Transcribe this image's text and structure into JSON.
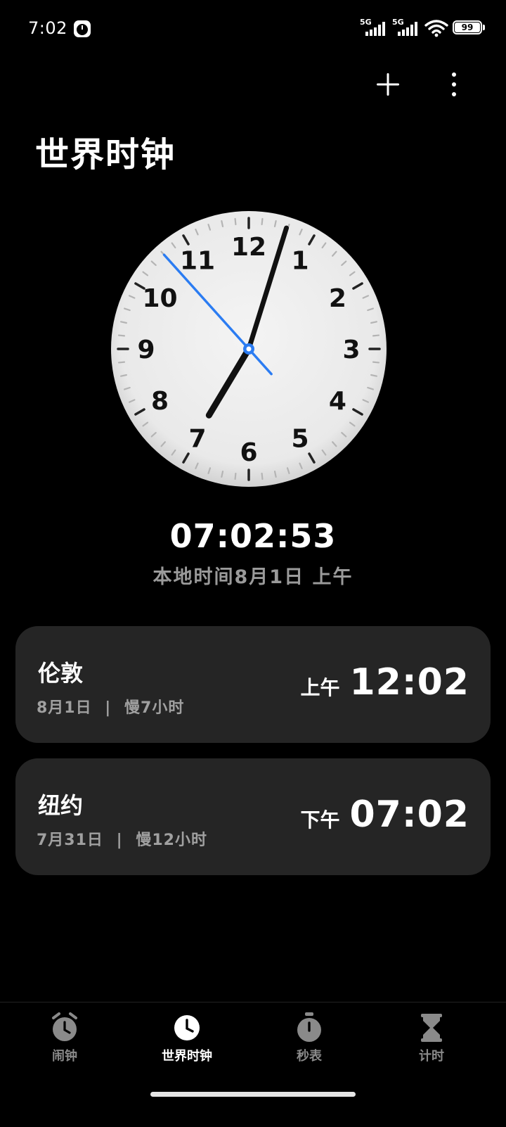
{
  "status_bar": {
    "time": "7:02",
    "signal1_tag": "5G",
    "signal2_tag": "5G",
    "battery": "99"
  },
  "header": {
    "title": "世界时钟"
  },
  "icons": {
    "add": "plus-icon",
    "more": "more-vertical-icon",
    "watch": "stopwatch-icon"
  },
  "analog_clock": {
    "numerals": [
      "12",
      "1",
      "2",
      "3",
      "4",
      "5",
      "6",
      "7",
      "8",
      "9",
      "10",
      "11"
    ],
    "hour": 7,
    "minute": 2,
    "second": 53,
    "second_hand_color": "#2b7cf2"
  },
  "local": {
    "time": "07:02:53",
    "date_label": "本地时间8月1日 上午"
  },
  "cities": [
    {
      "name": "伦敦",
      "date": "8月1日",
      "separator": "|",
      "offset": "慢7小时",
      "ampm": "上午",
      "time": "12:02"
    },
    {
      "name": "纽约",
      "date": "7月31日",
      "separator": "|",
      "offset": "慢12小时",
      "ampm": "下午",
      "time": "07:02"
    }
  ],
  "nav": {
    "items": [
      {
        "label": "闹钟",
        "icon": "alarm-icon",
        "active": false
      },
      {
        "label": "世界时钟",
        "icon": "clock-icon",
        "active": true
      },
      {
        "label": "秒表",
        "icon": "stopwatch-icon",
        "active": false
      },
      {
        "label": "计时",
        "icon": "hourglass-icon",
        "active": false
      }
    ]
  },
  "colors": {
    "background": "#000000",
    "card": "#252525",
    "accent": "#2b7cf2",
    "muted_text": "#9a9a9a"
  }
}
